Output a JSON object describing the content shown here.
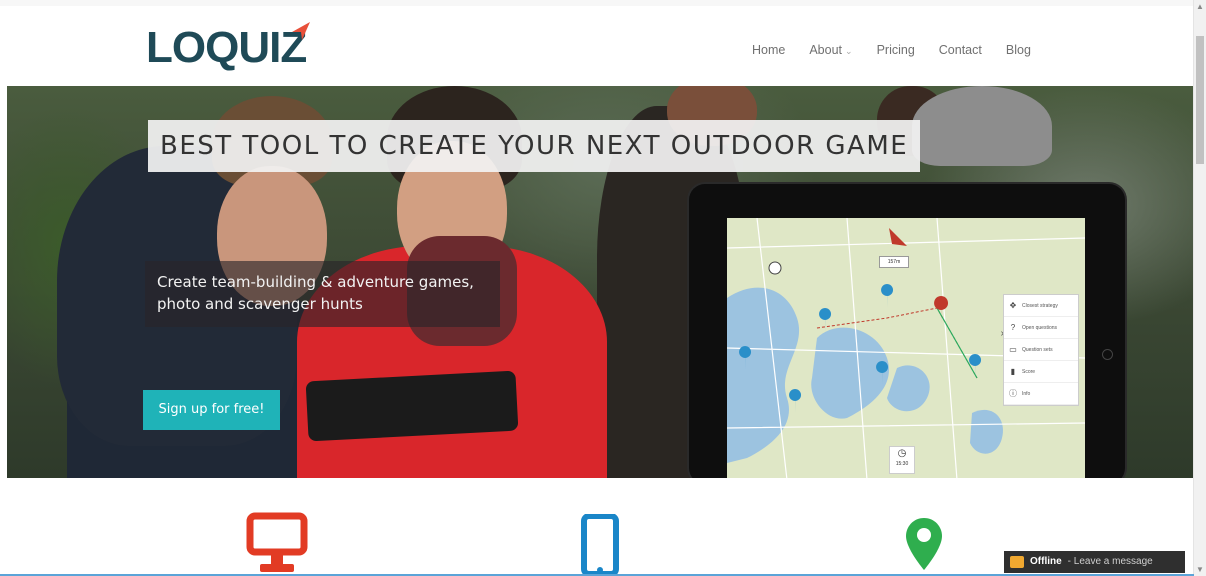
{
  "header": {
    "logo_text": "LOQUIZ",
    "nav": [
      {
        "label": "Home"
      },
      {
        "label": "About",
        "has_dropdown": true
      },
      {
        "label": "Pricing"
      },
      {
        "label": "Contact"
      },
      {
        "label": "Blog"
      }
    ]
  },
  "hero": {
    "title": "BEST TOOL TO CREATE YOUR NEXT OUTDOOR GAME",
    "subtitle_line1": "Create team-building & adventure games,",
    "subtitle_line2": "photo and scavenger hunts",
    "cta_label": "Sign up for free!",
    "cta_color": "#1fb3b8"
  },
  "map_panel": {
    "distance_badge": "157m",
    "items": [
      {
        "icon": "arrows-icon",
        "label": "Closest strategy"
      },
      {
        "icon": "question-icon",
        "label": "Open questions"
      },
      {
        "icon": "ruler-icon",
        "label": "Question sets"
      },
      {
        "icon": "signal-icon",
        "label": "Score"
      },
      {
        "icon": "info-icon",
        "label": "Info"
      }
    ],
    "compass_label": "15:30"
  },
  "features": [
    {
      "icon": "monitor-icon",
      "color": "#e23b24"
    },
    {
      "icon": "phone-icon",
      "color": "#1a86c8"
    },
    {
      "icon": "map-pin-icon",
      "color": "#2fae4e"
    }
  ],
  "chat": {
    "status": "Offline",
    "message": "- Leave a message"
  }
}
